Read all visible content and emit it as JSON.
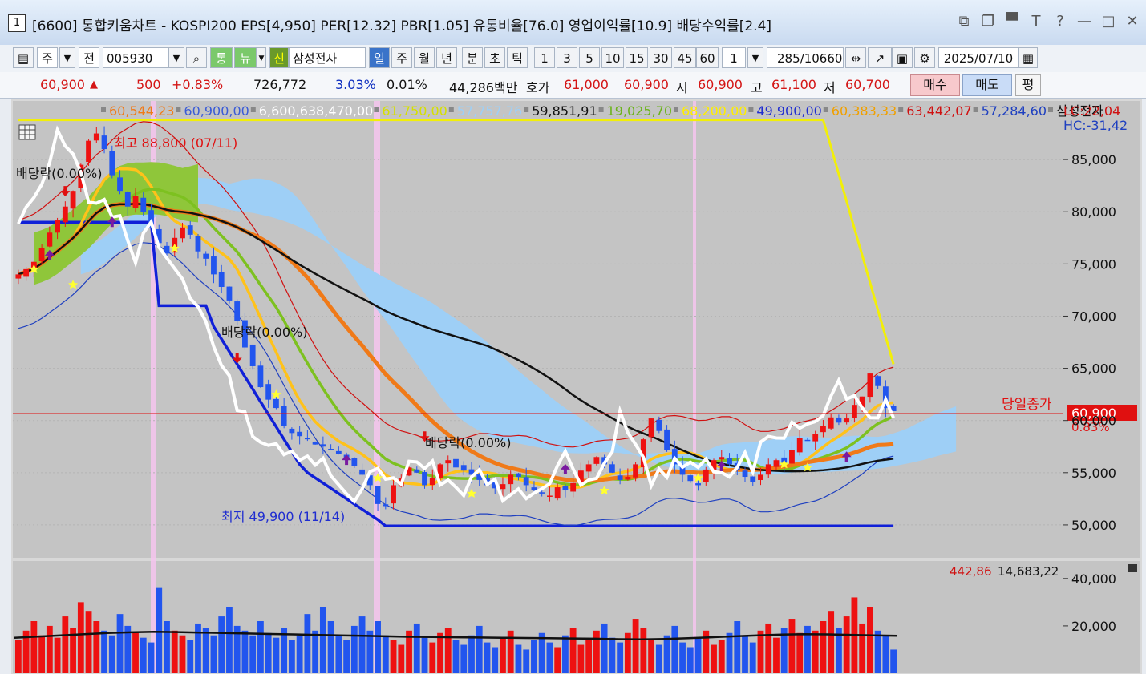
{
  "window": {
    "number": "1",
    "title": "[6600] 통합키움차트 - KOSPI200 EPS[4,950] PER[12.32] PBR[1.05] 유통비율[76.0] 영업이익률[10.9] 배당수익률[2.4]",
    "icons": [
      "link-icon",
      "copy-window-icon",
      "pin-icon",
      "font-icon",
      "help-icon",
      "minimize-icon",
      "maximize-icon",
      "close-icon"
    ]
  },
  "toolbar": {
    "period_select": "주",
    "prev_button": "전",
    "code": "005930",
    "buttons": [
      "통",
      "뉴"
    ],
    "new_badge": "신",
    "stock_name": "삼성전자",
    "timeframes": [
      "일",
      "주",
      "월",
      "년",
      "분",
      "초",
      "틱"
    ],
    "active_timeframe": "일",
    "intervals": [
      "1",
      "3",
      "5",
      "10",
      "15",
      "30",
      "45",
      "60"
    ],
    "count_value": "1",
    "count_display": "285",
    "count_total": "/10660",
    "date": "2025/07/10"
  },
  "quote": {
    "price": "60,900",
    "change": "500",
    "change_pct": "+0.83%",
    "volume": "726,772",
    "volume_rate": "3.03%",
    "turnover_rate": "0.01%",
    "amount": "44,286백만",
    "ask_label": "호가",
    "ask": "61,000",
    "bid": "60,900",
    "open_label": "시",
    "open": "60,900",
    "high_label": "고",
    "high": "61,100",
    "low_label": "저",
    "low": "60,700",
    "buy_button": "매수",
    "sell_button": "매도",
    "eval_button": "평"
  },
  "colors": {
    "up": "#ee1111",
    "down": "#2255ee",
    "ichimoku_cloud": "#9ecff6",
    "ma_orange": "#f07a18",
    "ma_black": "#111111",
    "pane_bg": "#c4c4c4"
  },
  "legend": [
    {
      "text": "60,544,23",
      "color": "#f07a18"
    },
    {
      "text": "60,900,00",
      "color": "#3a5bd6"
    },
    {
      "text": "6,600,638,470,00",
      "color": "#ffffff"
    },
    {
      "text": "61,750,00",
      "color": "#d6e000"
    },
    {
      "text": "57,757,76",
      "color": "#9ecff6"
    },
    {
      "text": "59,851,91",
      "color": "#111111"
    },
    {
      "text": "19,025,70",
      "color": "#6bb31a"
    },
    {
      "text": "68,200,00",
      "color": "#ffee00"
    },
    {
      "text": "49,900,00",
      "color": "#1f2dd0"
    },
    {
      "text": "60,383,33",
      "color": "#f0a000"
    },
    {
      "text": "63,442,07",
      "color": "#d01010"
    },
    {
      "text": "57,284,60",
      "color": "#1f40c0"
    },
    {
      "text": "삼성전자",
      "color": "#111111"
    }
  ],
  "lc_hc": {
    "lc": "LC:22,04",
    "hc": "HC:-31,42"
  },
  "annotations": {
    "high": "최고 88,800 (07/11)",
    "low": "최저 49,900 (11/14)",
    "ex_div": "배당락(0.00%)",
    "close_label": "당일종가",
    "close_value": "60,900",
    "close_pct": "0.83%"
  },
  "price_axis": [
    "85,000",
    "80,000",
    "75,000",
    "70,000",
    "65,000",
    "60,000",
    "55,000",
    "50,000"
  ],
  "volume_legend": {
    "a": "442,86",
    "b": "14,683,22"
  },
  "volume_axis": [
    "40,000",
    "20,000"
  ],
  "chart_data": {
    "type": "line",
    "price_range": [
      47000,
      90000
    ],
    "candles_close": [
      74000,
      74500,
      75200,
      76500,
      78000,
      79200,
      80500,
      82000,
      84500,
      86800,
      87500,
      86000,
      83500,
      82000,
      80500,
      81500,
      80000,
      78500,
      77000,
      76000,
      77500,
      78500,
      77800,
      76200,
      75500,
      74000,
      72800,
      71500,
      69500,
      67000,
      65200,
      63200,
      62000,
      61200,
      59500,
      58800,
      58500,
      58200,
      57700,
      57500,
      57200,
      56800,
      56200,
      55600,
      54800,
      53800,
      52000,
      51800,
      53800,
      54500,
      55500,
      55000,
      53800,
      54500,
      55800,
      56200,
      55500,
      55200,
      54800,
      54300,
      53800,
      53500,
      53900,
      54800,
      54600,
      53800,
      53300,
      53000,
      52800,
      53600,
      53300,
      54000,
      55200,
      55800,
      56500,
      55800,
      55000,
      54300,
      54600,
      55800,
      58200,
      60200,
      59000,
      57200,
      55800,
      54800,
      54200,
      53800,
      55300,
      56200,
      56500,
      55800,
      55300,
      54600,
      54100,
      54800,
      55800,
      56200,
      55900,
      57200,
      58300,
      58100,
      58700,
      59500,
      60300,
      59800,
      60200,
      61500,
      62300,
      64500,
      63300,
      61200,
      60900
    ],
    "volume_values": [
      14000,
      18000,
      22000,
      16000,
      20000,
      15000,
      24000,
      19000,
      30000,
      26000,
      22000,
      18000,
      16000,
      25000,
      20000,
      17000,
      15000,
      13000,
      36000,
      22000,
      18000,
      16000,
      14000,
      21000,
      19000,
      16000,
      24000,
      28000,
      20000,
      18000,
      16000,
      22000,
      17000,
      15000,
      19000,
      14000,
      16000,
      25000,
      18000,
      28000,
      22000,
      16000,
      14000,
      20000,
      24000,
      18000,
      22000,
      16000,
      14000,
      12000,
      18000,
      21000,
      15000,
      13000,
      17000,
      19000,
      14000,
      12000,
      16000,
      20000,
      13000,
      11000,
      15000,
      18000,
      12000,
      10000,
      14000,
      17000,
      13000,
      11000,
      16000,
      19000,
      12000,
      14000,
      18000,
      21000,
      15000,
      13000,
      17000,
      23000,
      19000,
      14000,
      12000,
      16000,
      20000,
      13000,
      11000,
      15000,
      18000,
      12000,
      14000,
      17000,
      22000,
      16000,
      13000,
      18000,
      21000,
      15000,
      19000,
      23000,
      17000,
      20000,
      18000,
      22000,
      26000,
      19000,
      24000,
      32000,
      21000,
      28000,
      18000,
      16000,
      10000
    ],
    "volume_range": [
      0,
      44000
    ],
    "volume_ma": [
      15000,
      15500,
      16000,
      16500,
      17000,
      17300,
      17500,
      17400,
      17200,
      17000,
      16800,
      16600,
      16400,
      16200,
      16000,
      15800,
      15600,
      15400,
      15300,
      15200,
      15100,
      15000,
      14900,
      14800,
      14700,
      14600,
      14400,
      14300,
      14500,
      14800,
      15200,
      15600,
      16000,
      16300,
      16500,
      16400,
      16200,
      16000,
      15800
    ]
  }
}
